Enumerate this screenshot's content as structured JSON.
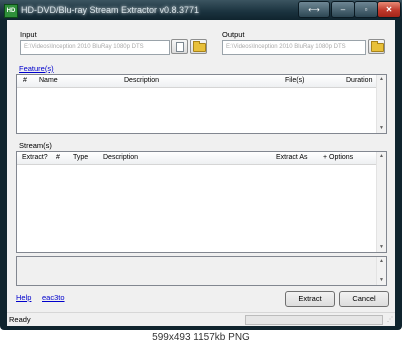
{
  "window": {
    "title": "HD-DVD/Blu-ray Stream Extractor v0.8.3771",
    "icon_text": "HD",
    "buttons": {
      "resize": "⟷",
      "minimize": "‒",
      "maximize": "▫",
      "close": "✕"
    }
  },
  "input": {
    "label": "Input",
    "value": "E:\\Videos\\Inception 2010 BluRay 1080p DTS"
  },
  "output": {
    "label": "Output",
    "value": "E:\\Videos\\Inception 2010 BluRay 1080p DTS"
  },
  "features": {
    "label": "Feature(s)",
    "columns": [
      "#",
      "Name",
      "Description",
      "File(s)",
      "Duration"
    ]
  },
  "streams": {
    "label": "Stream(s)",
    "columns": [
      "Extract?",
      "#",
      "Type",
      "Description",
      "Extract As",
      "+ Options"
    ]
  },
  "links": {
    "help": "Help",
    "eac3to": "eac3to"
  },
  "actions": {
    "extract": "Extract",
    "cancel": "Cancel"
  },
  "status": {
    "text": "Ready",
    "progress": 0
  },
  "image_caption": "599x493  1157kb  PNG"
}
